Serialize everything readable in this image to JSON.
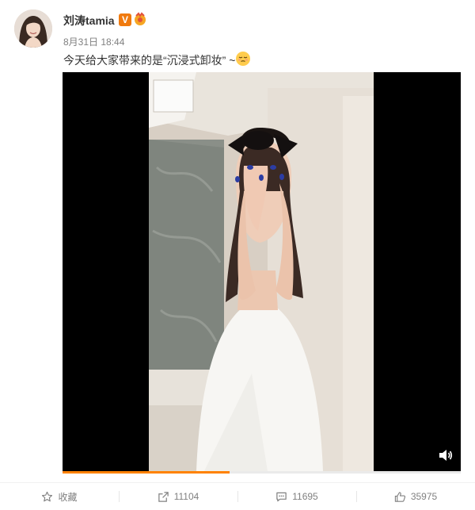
{
  "post": {
    "author": "刘涛tamia",
    "verified_badge": "V",
    "timestamp": "8月31日 18:44",
    "text": "今天给大家带来的是“沉浸式卸妆” ~",
    "emoji_icon": "sleepy-face-emoji-icon"
  },
  "video": {
    "progress_percent": 42,
    "volume_icon": "volume-icon"
  },
  "actions": {
    "favorite": {
      "icon": "star-icon",
      "label": "收藏"
    },
    "repost": {
      "icon": "share-icon",
      "label": "11104"
    },
    "comment": {
      "icon": "comment-icon",
      "label": "11695"
    },
    "like": {
      "icon": "thumbs-up-icon",
      "label": "35975"
    }
  },
  "colors": {
    "accent": "#ff8200",
    "text_gray": "#808080",
    "verified_orange": "#f07a0e"
  }
}
